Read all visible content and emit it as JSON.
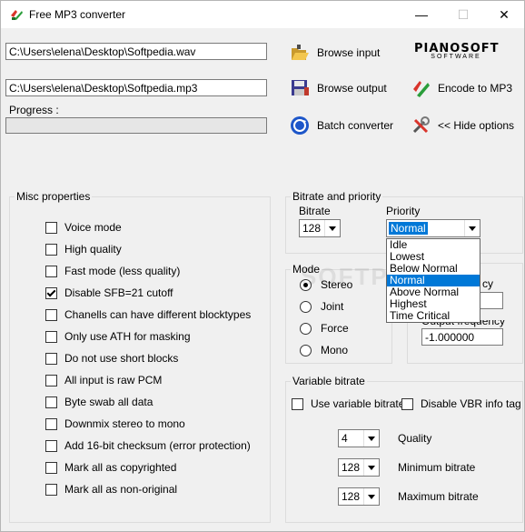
{
  "window": {
    "title": "Free MP3 converter",
    "minimize": "—",
    "maximize": "☐",
    "close": "✕"
  },
  "input_path": "C:\\Users\\elena\\Desktop\\Softpedia.wav",
  "output_path": "C:\\Users\\elena\\Desktop\\Softpedia.mp3",
  "progress_label": "Progress :",
  "progress": 0,
  "buttons": {
    "browse_input": "Browse input",
    "browse_output": "Browse output",
    "batch_converter": "Batch converter",
    "encode": "Encode to MP3",
    "hide_options": "<< Hide options"
  },
  "brand": {
    "name": "PIANOSOFT",
    "sub": "SOFTWARE"
  },
  "misc": {
    "title": "Misc properties",
    "options": [
      {
        "label": "Voice mode",
        "checked": false
      },
      {
        "label": "High quality",
        "checked": false
      },
      {
        "label": "Fast mode (less quality)",
        "checked": false
      },
      {
        "label": "Disable SFB=21 cutoff",
        "checked": true
      },
      {
        "label": "Chanells can have different blocktypes",
        "checked": false
      },
      {
        "label": "Only use ATH for masking",
        "checked": false
      },
      {
        "label": "Do not use short blocks",
        "checked": false
      },
      {
        "label": "All input is raw PCM",
        "checked": false
      },
      {
        "label": "Byte swab all data",
        "checked": false
      },
      {
        "label": "Downmix stereo to mono",
        "checked": false
      },
      {
        "label": "Add 16-bit checksum (error protection)",
        "checked": false
      },
      {
        "label": "Mark all as copyrighted",
        "checked": false
      },
      {
        "label": "Mark all as non-original",
        "checked": false
      }
    ]
  },
  "bitrate_priority": {
    "title": "Bitrate and priority",
    "bitrate_label": "Bitrate",
    "bitrate": "128",
    "priority_label": "Priority",
    "priority": "Normal",
    "priority_options": [
      "Idle",
      "Lowest",
      "Below Normal",
      "Normal",
      "Above Normal",
      "Highest",
      "Time Critical"
    ]
  },
  "mode": {
    "title": "Mode",
    "options": [
      {
        "label": "Stereo",
        "selected": true
      },
      {
        "label": "Joint",
        "selected": false
      },
      {
        "label": "Force",
        "selected": false
      },
      {
        "label": "Mono",
        "selected": false
      }
    ]
  },
  "frequency": {
    "label_partial_1": "cy",
    "value_1": "",
    "label_partial_2": "Output frequency",
    "value_2": "-1.000000"
  },
  "vbr": {
    "title": "Variable bitrate",
    "use_vbr": "Use variable bitrate",
    "disable_info": "Disable VBR info tag",
    "quality_label": "Quality",
    "quality": "4",
    "min_label": "Minimum bitrate",
    "min": "128",
    "max_label": "Maximum bitrate",
    "max": "128"
  },
  "watermark": "SOFTPEDIA"
}
